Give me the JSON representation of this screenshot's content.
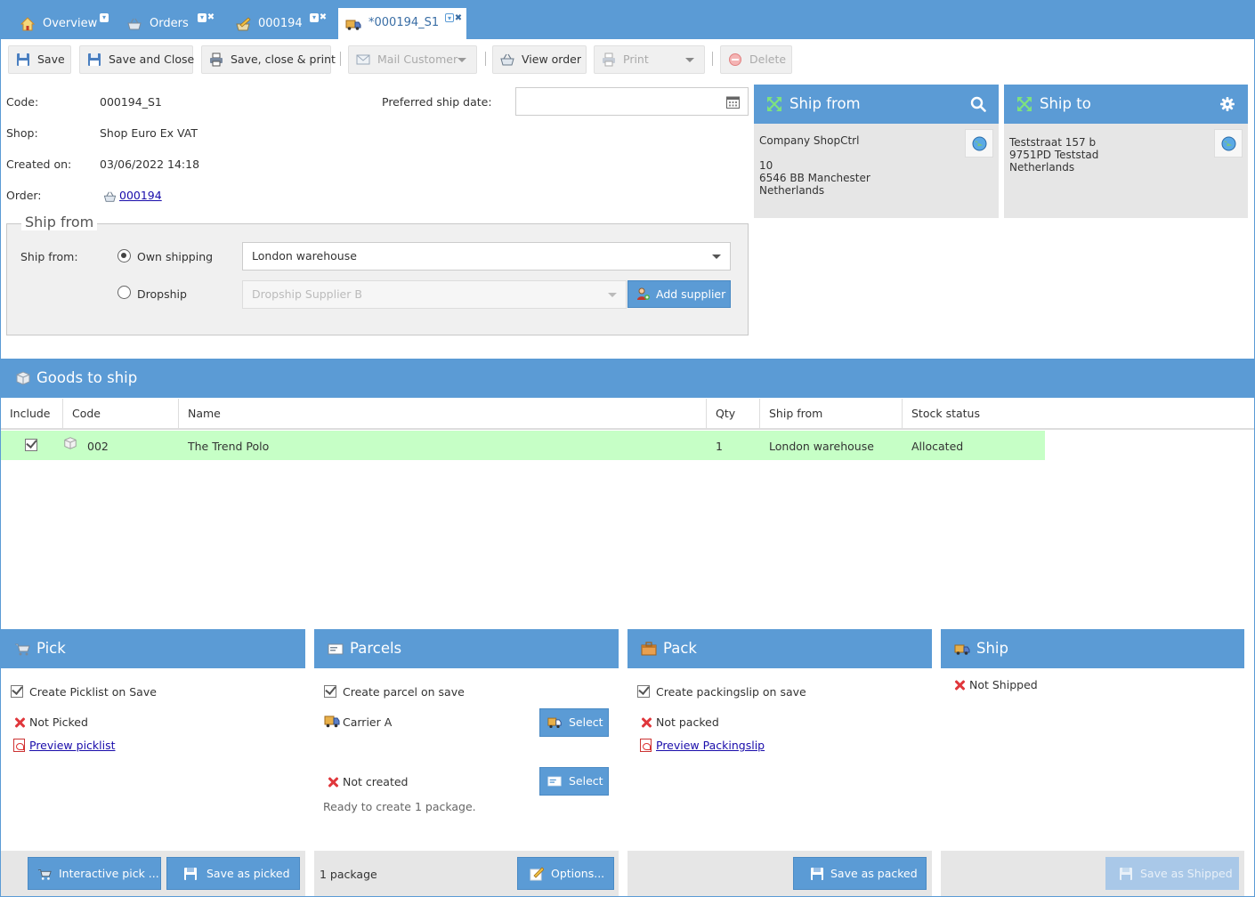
{
  "tabs": [
    {
      "label": "Overview",
      "icon": "home-icon"
    },
    {
      "label": "Orders",
      "icon": "basket-icon"
    },
    {
      "label": "000194",
      "icon": "edit-order-icon"
    },
    {
      "label": "*000194_S1",
      "icon": "truck-icon"
    }
  ],
  "toolbar": {
    "save": "Save",
    "save_close": "Save and Close",
    "save_close_print": "Save, close & print",
    "mail_customer": "Mail Customer",
    "view_order": "View order",
    "print": "Print",
    "delete": "Delete"
  },
  "form": {
    "code_label": "Code:",
    "code_value": "000194_S1",
    "shop_label": "Shop:",
    "shop_value": "Shop Euro Ex VAT",
    "created_label": "Created on:",
    "created_value": "03/06/2022 14:18",
    "order_label": "Order:",
    "order_value": "000194",
    "pref_ship_label": "Preferred ship date:",
    "pref_ship_value": ""
  },
  "ship_from_group": {
    "legend": "Ship from",
    "label": "Ship from:",
    "own_shipping": "Own shipping",
    "dropship": "Dropship",
    "warehouse_value": "London warehouse",
    "supplier_value": "Dropship Supplier B",
    "add_supplier": "Add supplier",
    "selected": "own_shipping"
  },
  "ship_from_box": {
    "title": "Ship from",
    "address": "Company ShopCtrl\n\n10\n6546 BB Manchester\nNetherlands"
  },
  "ship_to_box": {
    "title": "Ship to",
    "address": "Teststraat 157 b\n9751PD Teststad\nNetherlands"
  },
  "goods": {
    "title": "Goods to ship",
    "columns": [
      "Include",
      "Code",
      "Name",
      "Qty",
      "Ship from",
      "Stock status"
    ],
    "rows": [
      {
        "include": true,
        "code": "002",
        "name": "The Trend Polo",
        "qty": "1",
        "ship_from": "London warehouse",
        "stock_status": "Allocated"
      }
    ]
  },
  "pick": {
    "title": "Pick",
    "create_picklist": "Create Picklist on Save",
    "status": "Not Picked",
    "preview": "Preview picklist",
    "interactive_pick": "Interactive pick ...",
    "save_as_picked": "Save as picked"
  },
  "parcels": {
    "title": "Parcels",
    "create_parcel": "Create parcel on save",
    "carrier": "Carrier A",
    "select_carrier": "Select",
    "status": "Not created",
    "select_parcel": "Select",
    "ready_text": "Ready to create 1 package.",
    "package_count": "1 package",
    "options": "Options..."
  },
  "pack": {
    "title": "Pack",
    "create_packingslip": "Create packingslip on save",
    "status": "Not packed",
    "preview": "Preview Packingslip",
    "save_as_packed": "Save as packed"
  },
  "ship": {
    "title": "Ship",
    "status": "Not Shipped",
    "save_as_shipped": "Save as Shipped"
  },
  "colors": {
    "accent": "#5b9bd5",
    "row_highlight": "#c6ffc6",
    "error": "#e0373c",
    "panel_bg": "#e6e6e6"
  }
}
